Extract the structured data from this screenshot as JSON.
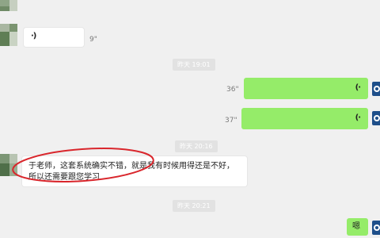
{
  "messages": {
    "voice1": {
      "icon": "voice-in-icon",
      "duration": "9\""
    },
    "time1": "昨天 19:01",
    "voice2": {
      "icon": "voice-out-icon",
      "duration": "36\""
    },
    "voice3": {
      "icon": "voice-out-icon",
      "duration": "37\""
    },
    "time2": "昨天 20:16",
    "text1": {
      "line1": "于老师，这套系统确实不错，就是我有时候用得还是不好，",
      "line2": "所以还需要跟您学习"
    },
    "time3": "昨天 20:21",
    "text2": "嗯"
  },
  "colors": {
    "outgoing_bubble": "#95ec69",
    "incoming_bubble": "#ffffff",
    "annotation": "#d9262c",
    "my_avatar": "#1e4f8a"
  }
}
